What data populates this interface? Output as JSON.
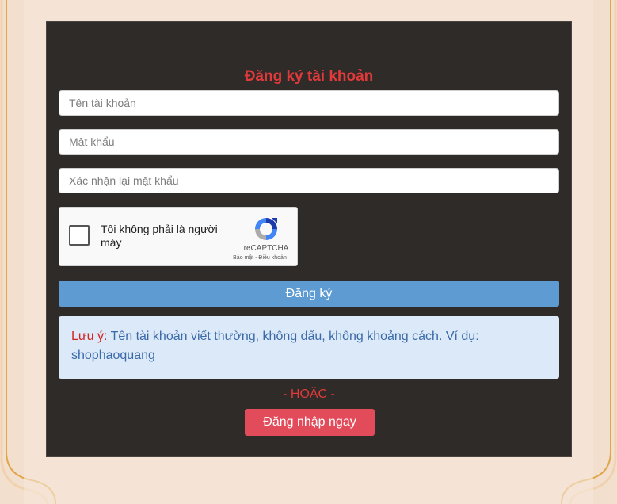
{
  "form": {
    "title": "Đăng ký tài khoản",
    "username_placeholder": "Tên tài khoản",
    "password_placeholder": "Mật khẩu",
    "confirm_placeholder": "Xác nhận lại mật khẩu",
    "register_label": "Đăng ký"
  },
  "recaptcha": {
    "label": "Tôi không phải là người máy",
    "brand": "reCAPTCHA",
    "links": "Bảo mật - Điều khoản"
  },
  "note": {
    "label": "Lưu ý:",
    "text": " Tên tài khoản viết thường, không dấu, không khoảng cách. Ví dụ: shophaoquang"
  },
  "alt": {
    "separator": "- HOẶC -",
    "login_label": "Đăng nhập ngay"
  },
  "colors": {
    "panel_bg": "#2e2b29",
    "accent_red": "#e23a3a",
    "register_button": "#5e9bd2",
    "login_button": "#e24c5a",
    "note_bg": "#dce9f8"
  }
}
